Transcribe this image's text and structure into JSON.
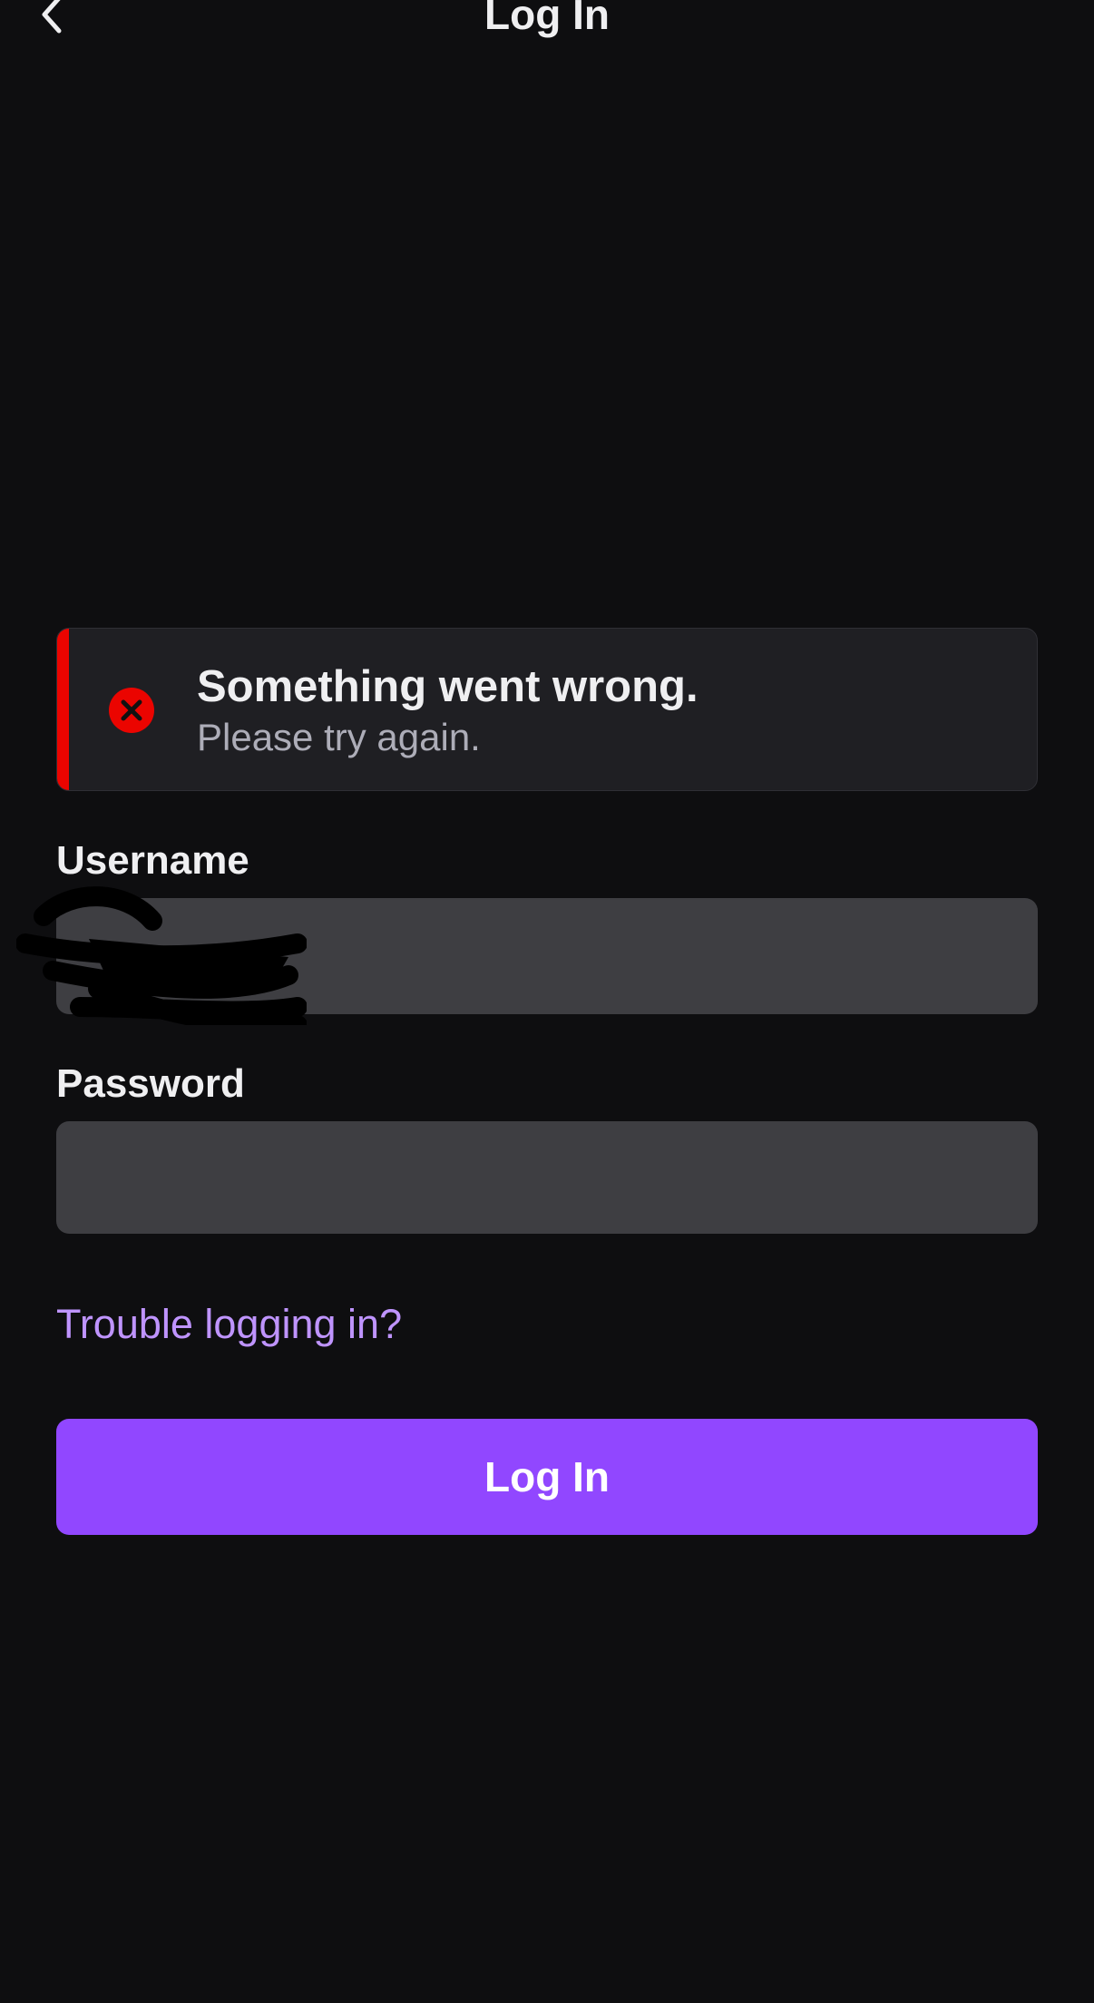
{
  "header": {
    "title": "Log In",
    "back_icon": "chevron-left-icon"
  },
  "error": {
    "title": "Something went wrong.",
    "message": "Please try again.",
    "icon": "error-circle-x-icon",
    "accent_color": "#eb0400"
  },
  "form": {
    "username_label": "Username",
    "username_value": "",
    "password_label": "Password",
    "password_value": "",
    "trouble_link": "Trouble logging in?",
    "submit_label": "Log In"
  },
  "colors": {
    "background": "#0e0e10",
    "primary": "#9147ff",
    "link": "#bf94ff",
    "input_bg": "#3e3e42"
  }
}
